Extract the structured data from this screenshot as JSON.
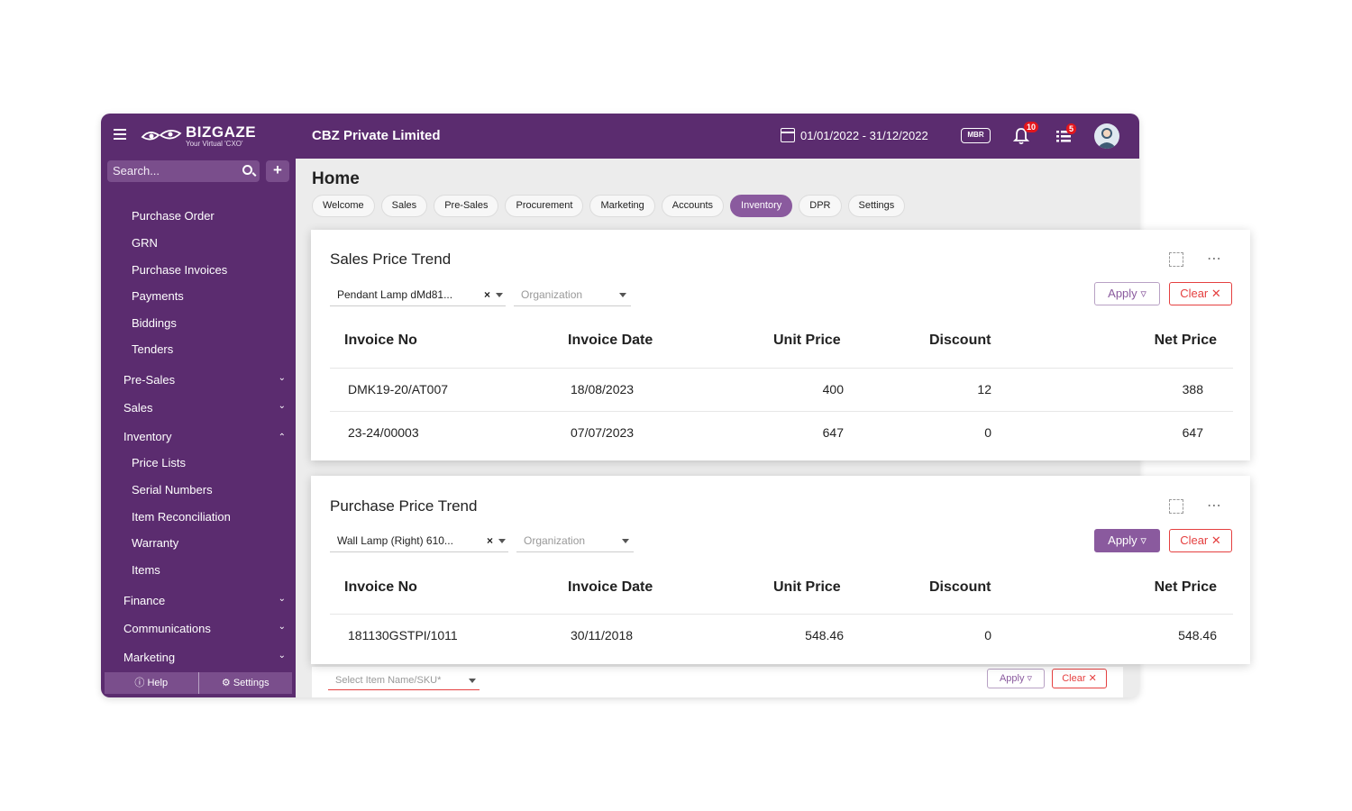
{
  "brand": {
    "name": "BIZGAZE",
    "tagline": "Your Virtual 'CXO'"
  },
  "header": {
    "company": "CBZ Private Limited",
    "date_range": "01/01/2022 - 31/12/2022",
    "mbr": "MBR",
    "notifications_count": "10",
    "tasks_count": "5"
  },
  "sidebar": {
    "search_placeholder": "Search...",
    "plus": "+",
    "items": [
      "Purchase Order",
      "GRN",
      "Purchase Invoices",
      "Payments",
      "Biddings",
      "Tenders"
    ],
    "groups": [
      "Pre-Sales",
      "Sales",
      "Inventory"
    ],
    "inventory_items": [
      "Price Lists",
      "Serial Numbers",
      "Item Reconciliation",
      "Warranty",
      "Items"
    ],
    "groups2": [
      "Finance",
      "Communications",
      "Marketing"
    ],
    "footer": {
      "help": "Help",
      "settings": "Settings"
    }
  },
  "main": {
    "title": "Home",
    "tabs": [
      "Welcome",
      "Sales",
      "Pre-Sales",
      "Procurement",
      "Marketing",
      "Accounts",
      "Inventory",
      "DPR",
      "Settings"
    ],
    "active_tab": "Inventory",
    "background_filter": {
      "item_placeholder": "Select Item Name/SKU*",
      "apply": "Apply",
      "clear": "Clear"
    }
  },
  "sales_card": {
    "title": "Sales Price Trend",
    "item_value": "Pendant Lamp dMd81...",
    "org_placeholder": "Organization",
    "apply": "Apply",
    "clear": "Clear",
    "columns": [
      "Invoice No",
      "Invoice Date",
      "Unit Price",
      "Discount",
      "Net Price"
    ],
    "rows": [
      [
        "DMK19-20/AT007",
        "18/08/2023",
        "400",
        "12",
        "388"
      ],
      [
        "23-24/00003",
        "07/07/2023",
        "647",
        "0",
        "647"
      ]
    ]
  },
  "purchase_card": {
    "title": "Purchase Price Trend",
    "item_value": "Wall Lamp (Right) 610...",
    "org_placeholder": "Organization",
    "apply": "Apply",
    "clear": "Clear",
    "columns": [
      "Invoice No",
      "Invoice Date",
      "Unit Price",
      "Discount",
      "Net Price"
    ],
    "rows": [
      [
        "181130GSTPI/1011",
        "30/11/2018",
        "548.46",
        "0",
        "548.46"
      ]
    ]
  },
  "colors": {
    "brand_purple": "#5b2c6f",
    "accent": "#8a5a9e",
    "danger": "#e54040",
    "badge": "#e4161c"
  }
}
